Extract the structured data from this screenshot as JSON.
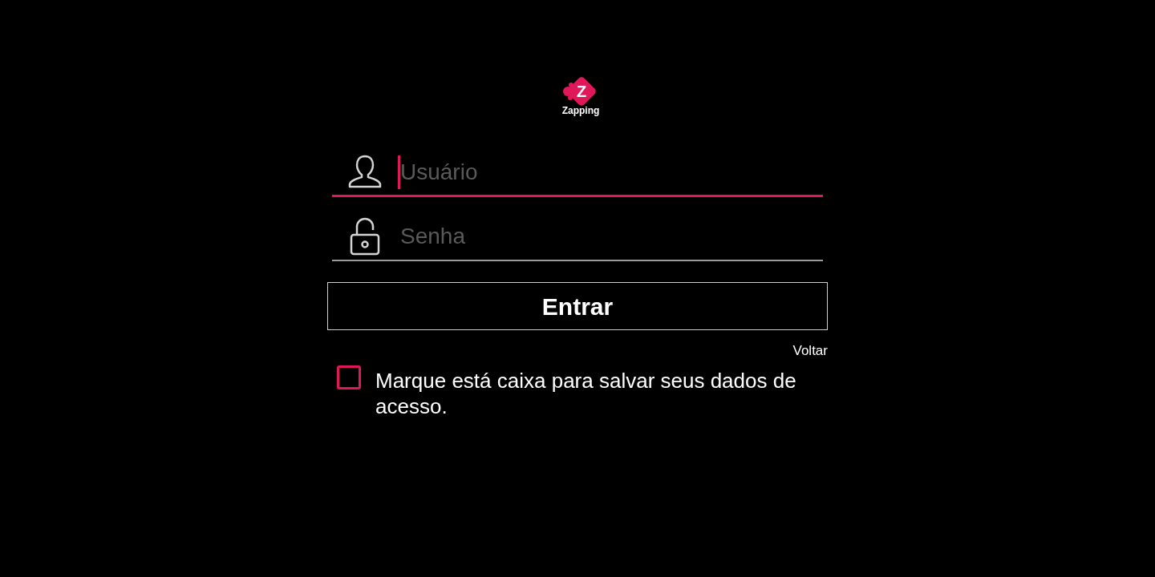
{
  "logo": {
    "letter": "Z",
    "name": "Zapping"
  },
  "fields": [
    {
      "kind": "user",
      "placeholder": "Usuário",
      "focused": true
    },
    {
      "kind": "password",
      "placeholder": "Senha",
      "focused": false
    }
  ],
  "submit": "Entrar",
  "back_link": "Voltar",
  "remember": {
    "label": "Marque está caixa para salvar seus dados de acesso.",
    "checked": false
  }
}
